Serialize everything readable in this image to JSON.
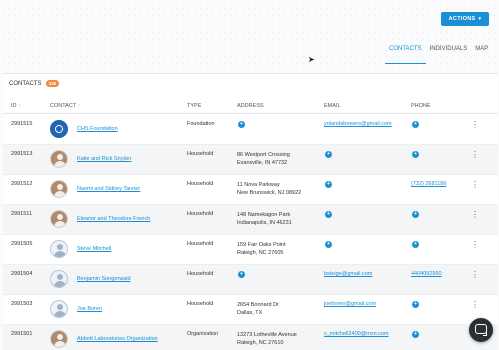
{
  "header": {
    "actions_label": "ACTIONS",
    "tabs": [
      {
        "label": "CONTACTS",
        "active": true
      },
      {
        "label": "INDIVIDUALS",
        "active": false
      },
      {
        "label": "MAP",
        "active": false
      }
    ]
  },
  "panel": {
    "title": "CONTACTS",
    "count": "336"
  },
  "table": {
    "columns": [
      "ID",
      "CONTACT",
      "TYPE",
      "ADDRESS",
      "EMAIL",
      "PHONE"
    ],
    "rows": [
      {
        "id": "2991515",
        "contact": "CHS Foundation",
        "avatar": "org",
        "type": "Foundation",
        "address_line1": "",
        "address_line2": "",
        "email": "yolandabowers@gmail.com",
        "phone": ""
      },
      {
        "id": "2991513",
        "contact": "Katie and Rick Snyder",
        "avatar": "photo",
        "type": "Household",
        "address_line1": "86 Westport Crossing",
        "address_line2": "Evansville, IN 47732",
        "email": "",
        "phone": ""
      },
      {
        "id": "2991512",
        "contact": "Naomi and Sidney Tanner",
        "avatar": "photo",
        "type": "Household",
        "address_line1": "11 Nova Parkway",
        "address_line2": "New Brunswick, NJ 08922",
        "email": "",
        "phone": "(732) 2681186"
      },
      {
        "id": "2991511",
        "contact": "Eleanor and Theodore French",
        "avatar": "photo",
        "type": "Household",
        "address_line1": "148 Namekagon Park",
        "address_line2": "Indianapolis, IN 46231",
        "email": "",
        "phone": ""
      },
      {
        "id": "2991505",
        "contact": "Steve Mitchell",
        "avatar": "person",
        "type": "Household",
        "address_line1": "159 Fair Oaks Point",
        "address_line2": "Raleigh, NC 27605",
        "email": "",
        "phone": ""
      },
      {
        "id": "2991504",
        "contact": "Benjamin Songerwald",
        "avatar": "person",
        "type": "Household",
        "address_line1": "",
        "address_line2": "",
        "email": "bsteige@gmail.com",
        "phone": "4404092960"
      },
      {
        "id": "2991503",
        "contact": "Joe Boren",
        "avatar": "person",
        "type": "Household",
        "address_line1": "2654 Bonnard Dr",
        "address_line2": "Dallas, TX",
        "email": "joeboren@gmail.com",
        "phone": ""
      },
      {
        "id": "2991501",
        "contact": "Abbott Laboratories Organization",
        "avatar": "photo",
        "type": "Organization",
        "address_line1": "13273 Lotheville Avenue",
        "address_line2": "Raleigh, NC 27610",
        "email": "s_mitchell2400@msn.com",
        "phone": ""
      }
    ]
  },
  "icons": {
    "add": "plus-circle-icon",
    "more": "kebab-icon",
    "chat": "chat-icon"
  },
  "colors": {
    "accent": "#1a8fd6",
    "badge": "#f08a3c",
    "row_shade": "#f3f5f7"
  }
}
